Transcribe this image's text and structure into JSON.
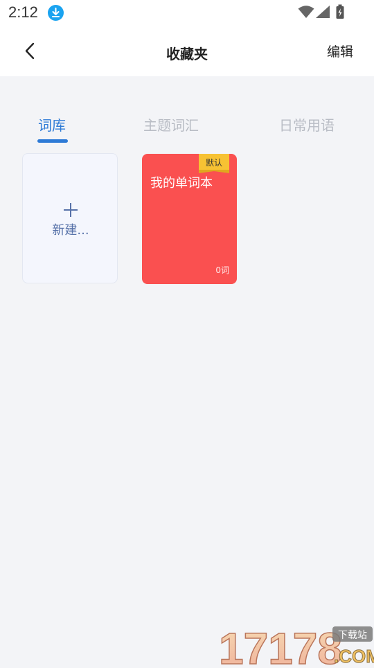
{
  "status_bar": {
    "time": "2:12",
    "icons": [
      "download-icon",
      "wifi-icon",
      "signal-icon",
      "battery-icon"
    ]
  },
  "header": {
    "title": "收藏夹",
    "edit_label": "编辑",
    "back_icon": "back-chevron-icon"
  },
  "tabs": [
    {
      "label": "词库",
      "active": true
    },
    {
      "label": "主题词汇",
      "active": false
    },
    {
      "label": "日常用语",
      "active": false
    }
  ],
  "cards": {
    "new_card": {
      "icon": "plus-icon",
      "label": "新建..."
    },
    "word_book": {
      "title": "我的单词本",
      "badge": "默认",
      "count": "0词"
    }
  },
  "watermark": {
    "main": "17178",
    "badge": "下载站",
    "domain": ".COM"
  },
  "colors": {
    "accent": "#2d7ad6",
    "card_red": "#fa5050",
    "badge_yellow": "#f7c233",
    "background": "#f3f4f7"
  }
}
